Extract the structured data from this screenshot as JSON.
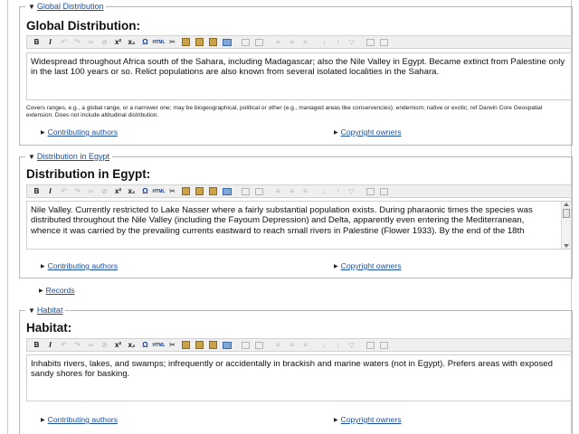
{
  "toolbar": {
    "buttons": [
      "B",
      "I",
      "↶",
      "↷",
      "∞",
      "⊘",
      "x²",
      "x₂",
      "Ω",
      "HTML",
      "✂",
      "copy",
      "paste",
      "paste-text",
      "edit",
      "table",
      "table2",
      "indent",
      "outdent",
      "list",
      "sort-az",
      "sort-za",
      "filter",
      "grid",
      "grid2"
    ]
  },
  "sections": [
    {
      "legend": "Global Distribution",
      "title": "Global Distribution:",
      "body": "Widespread throughout Africa south of the Sahara, including Madagascar; also the Nile Valley in Egypt. Became extinct from Palestine only in the last 100 years or so. Relict populations are also known from several isolated localities in the Sahara.",
      "help": "Covers ranges, e.g., a global range, or a narrower one; may be biogeographical, political or other (e.g., managed areas like conservencies); endemism; native or exotic; ref Darwin Core Geospatial extension. Does not include altitudinal distribution.",
      "contributing": "Contributing authors",
      "copyright": "Copyright owners"
    },
    {
      "legend": "Distribution in Egypt",
      "title": "Distribution in Egypt:",
      "body": "Nile Valley. Currently restricted to Lake Nasser where a fairly substantial population exists. During pharaonic times the species was distributed throughout the Nile Valley (including the Fayoum Depression) and Delta, apparently even entering the Mediterranean, whence it was carried by the prevailing currents eastward to reach small rivers in Palestine (Flower 1933). By the end of the 18th",
      "contributing": "Contributing authors",
      "copyright": "Copyright owners"
    },
    {
      "legend": "Habitat",
      "title": "Habitat:",
      "body": "Inhabits rivers, lakes, and swamps; infrequently or accidentally in brackish and marine waters (not in Egypt). Prefers areas with exposed sandy shores for basking.",
      "contributing": "Contributing authors",
      "copyright": "Copyright owners"
    }
  ],
  "records": "Records"
}
